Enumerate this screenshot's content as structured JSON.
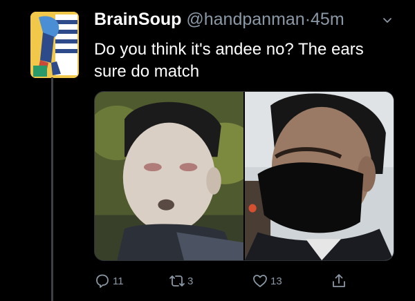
{
  "tweet": {
    "display_name": "BrainSoup",
    "handle": "@handpanman",
    "separator": "·",
    "time": "45m",
    "text": "Do you think it's andee no? The ears sure do match"
  },
  "media": {
    "count": 2,
    "images": [
      "photo-man-covered-in-white-substance",
      "photo-man-wearing-black-mask"
    ]
  },
  "actions": {
    "reply_count": "11",
    "retweet_count": "3",
    "like_count": "13"
  },
  "icons": {
    "reply": "reply-icon",
    "retweet": "retweet-icon",
    "like": "heart-icon",
    "share": "share-icon",
    "menu": "chevron-down-icon"
  },
  "colors": {
    "background": "#000000",
    "secondary_text": "#8b98a5",
    "avatar_bg": "#f2c84a"
  }
}
